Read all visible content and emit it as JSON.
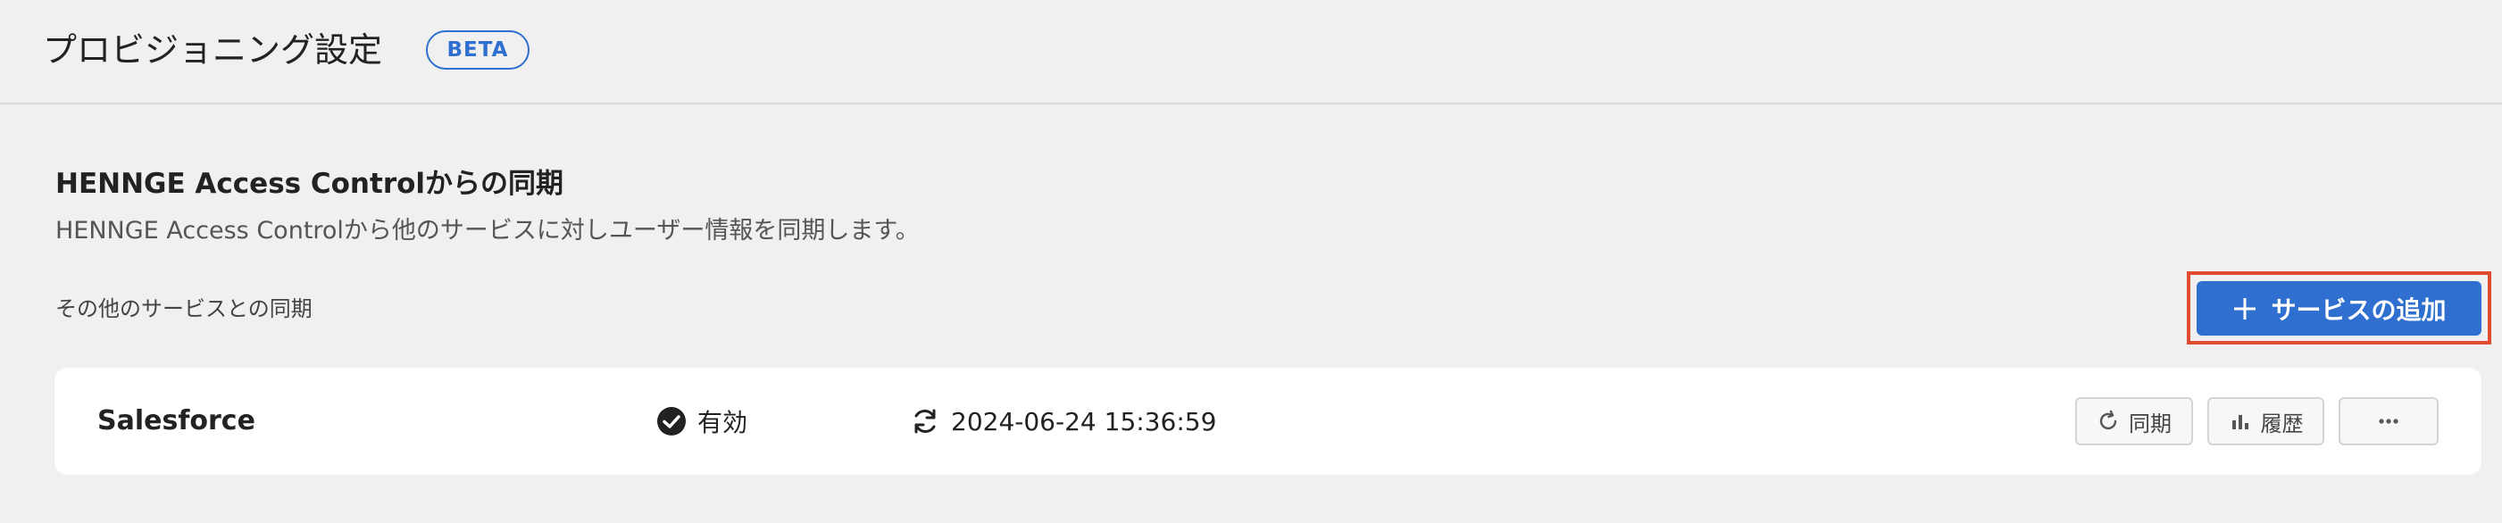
{
  "header": {
    "title": "プロビジョニング設定",
    "badge": "BETA"
  },
  "section": {
    "title": "HENNGE Access Controlからの同期",
    "description": "HENNGE Access Controlから他のサービスに対しユーザー情報を同期します。",
    "sub_label": "その他のサービスとの同期",
    "add_button_label": "サービスの追加",
    "add_button_icon": "plus-icon"
  },
  "services": [
    {
      "name": "Salesforce",
      "status": "有効",
      "status_icon": "check-circle-icon",
      "last_sync": "2024-06-24 15:36:59",
      "sync_icon": "sync-icon",
      "actions": {
        "sync_label": "同期",
        "sync_icon": "refresh-icon",
        "history_label": "履歴",
        "history_icon": "bar-chart-icon",
        "more_icon": "more-horizontal-icon"
      }
    }
  ],
  "colors": {
    "accent": "#2f6fd0",
    "highlight_border": "#e04a2f",
    "background": "#f0f0f0",
    "card": "#ffffff"
  }
}
